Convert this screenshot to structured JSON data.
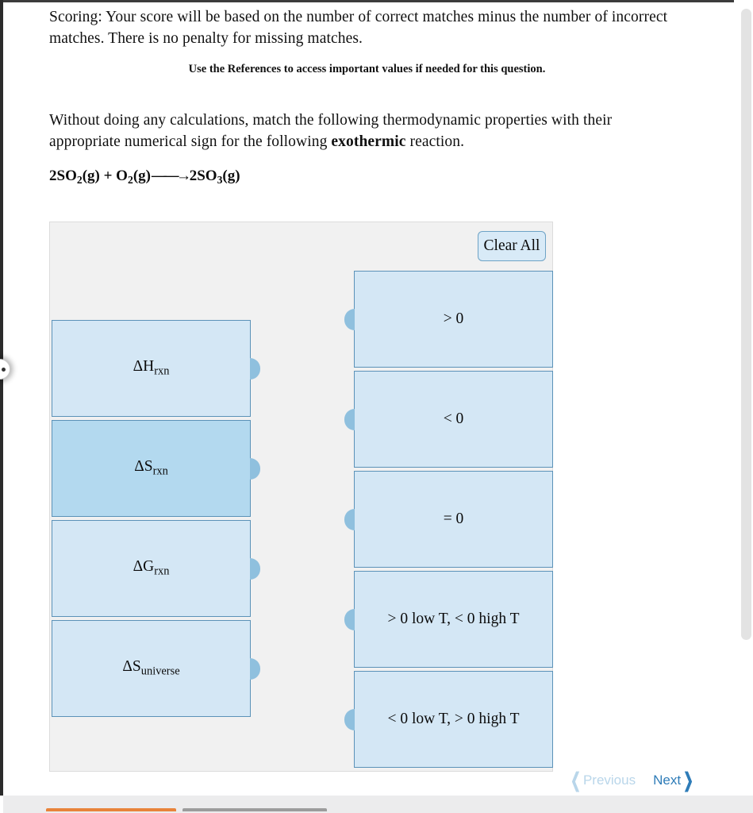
{
  "document": {
    "scoring_text": "Scoring: Your score will be based on the number of correct matches minus the number of incorrect matches. There is no penalty for missing matches.",
    "references_line": "Use the References to access important values if needed for this question.",
    "prompt_prefix": "Without doing any calculations, match the following thermodynamic properties with their appropriate numerical sign for the following ",
    "prompt_bold": "exothermic",
    "prompt_suffix": " reaction.",
    "equation": {
      "coefficient_1": "2SO",
      "sub_1": "2",
      "state_1": "(g) + O",
      "sub_2": "2",
      "state_2": "(g)",
      "arrow": "——→",
      "coefficient_3": "2SO",
      "sub_3": "3",
      "state_3": "(g)",
      "plain_text": "2SO2(g) + O2(g) ⟶ 2SO3(g)"
    }
  },
  "match_panel": {
    "clear_all_label": "Clear All",
    "left_tiles": [
      {
        "symbol": "ΔH",
        "subscript": "rxn",
        "plain": "ΔHrxn",
        "selected": false
      },
      {
        "symbol": "ΔS",
        "subscript": "rxn",
        "plain": "ΔSrxn",
        "selected": true
      },
      {
        "symbol": "ΔG",
        "subscript": "rxn",
        "plain": "ΔGrxn",
        "selected": false
      },
      {
        "symbol": "ΔS",
        "subscript": "universe",
        "plain": "ΔSuniverse",
        "selected": false
      }
    ],
    "right_tiles": [
      {
        "label": "> 0"
      },
      {
        "label": "< 0"
      },
      {
        "label": "= 0"
      },
      {
        "label": "> 0 low T, < 0 high T"
      },
      {
        "label": "< 0 low T, > 0 high T"
      }
    ]
  },
  "navigation": {
    "previous_label": "Previous",
    "next_label": "Next",
    "previous_chevron": "❮",
    "next_chevron": "❯"
  },
  "colors": {
    "tile_fill": "#d4e7f5",
    "tile_fill_selected": "#b3d9ef",
    "tile_border": "#5b92b8",
    "nub": "#8fc0de",
    "panel_bg": "#f1f1f1",
    "clear_all_bg": "#d8eaf7",
    "next_blue": "#2e7cb8",
    "previous_disabled": "#b9d6ea",
    "footer_orange": "#e8833a",
    "footer_grey": "#9c9c9c"
  }
}
